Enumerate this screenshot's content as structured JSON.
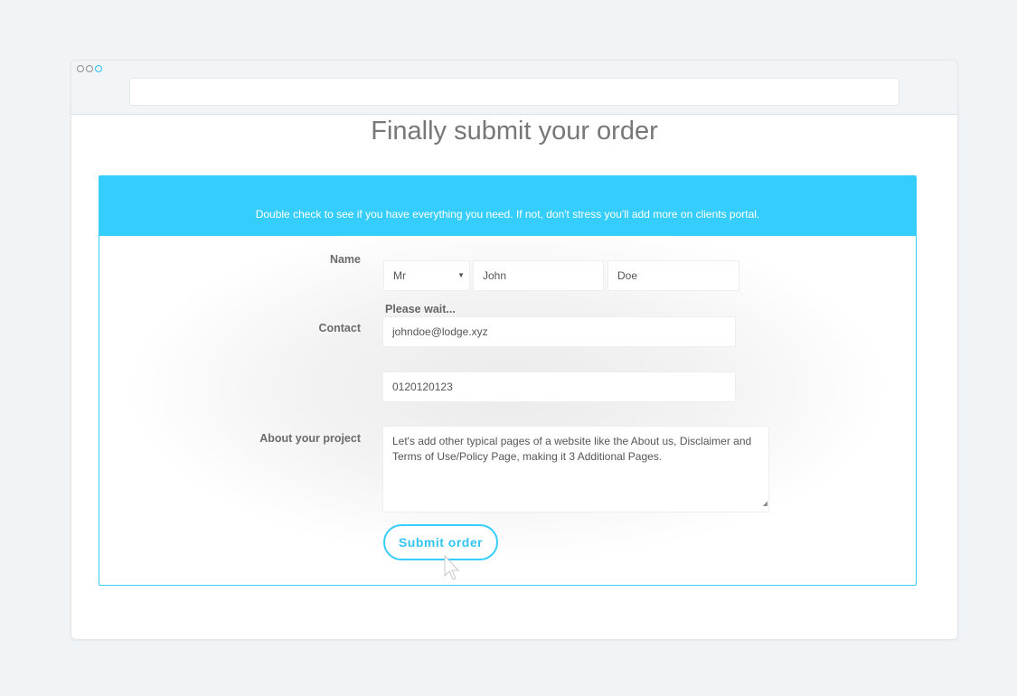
{
  "page": {
    "title": "Finally submit your order"
  },
  "form": {
    "header_text": "Double check to see if you have everything you need. If not, don't stress you'll add more on clients portal.",
    "name_label": "Name",
    "title_value": "Mr",
    "first_name_value": "John",
    "last_name_value": "Doe",
    "status_text": "Please wait...",
    "contact_label": "Contact",
    "email_value": "johndoe@lodge.xyz",
    "phone_value": "0120120123",
    "project_label": "About your project",
    "project_value": "Let's add other typical pages of a website like the About us, Disclaimer and Terms of Use/Policy Page, making it 3 Additional Pages.",
    "submit_label": "Submit order"
  },
  "icons": {
    "window_controls": [
      "window-dot-icon",
      "window-dot-icon",
      "window-dot-icon"
    ],
    "select_caret": "chevron-down-icon",
    "cursor": "cursor-icon"
  },
  "colors": {
    "accent": "#35cdfb",
    "background": "#f1f4f6",
    "title": "#777777"
  }
}
